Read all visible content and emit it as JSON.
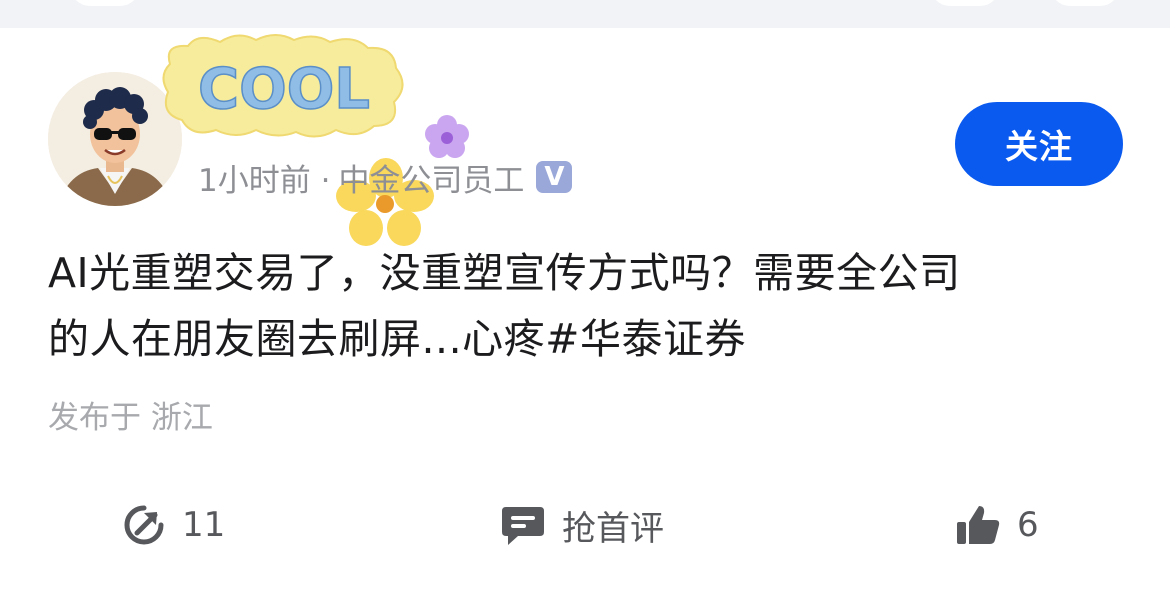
{
  "post": {
    "meta_time": "1小时前 ·",
    "meta_company": "中金公司员工",
    "verified_badge": "V",
    "follow_button": "关注",
    "text_line1": "AI光重塑交易了，没重塑宣传方式吗？需要全公司",
    "text_line2": "的人在朋友圈去刷屏...心疼#华泰证券",
    "location": "发布于 浙江"
  },
  "sticker": {
    "text": "COOL"
  },
  "actions": {
    "repost_count": "11",
    "comment_label": "抢首评",
    "like_count": "6"
  },
  "colors": {
    "accent": "#0a5af0",
    "text_primary": "#1c1c1e",
    "text_secondary": "#8d8f94",
    "text_muted": "#a7a9ad",
    "icon": "#56585c"
  },
  "icons": {
    "repost": "repost-arrow-icon",
    "comment": "comment-bubble-icon",
    "like": "thumbs-up-icon",
    "verified": "verified-badge-icon"
  }
}
